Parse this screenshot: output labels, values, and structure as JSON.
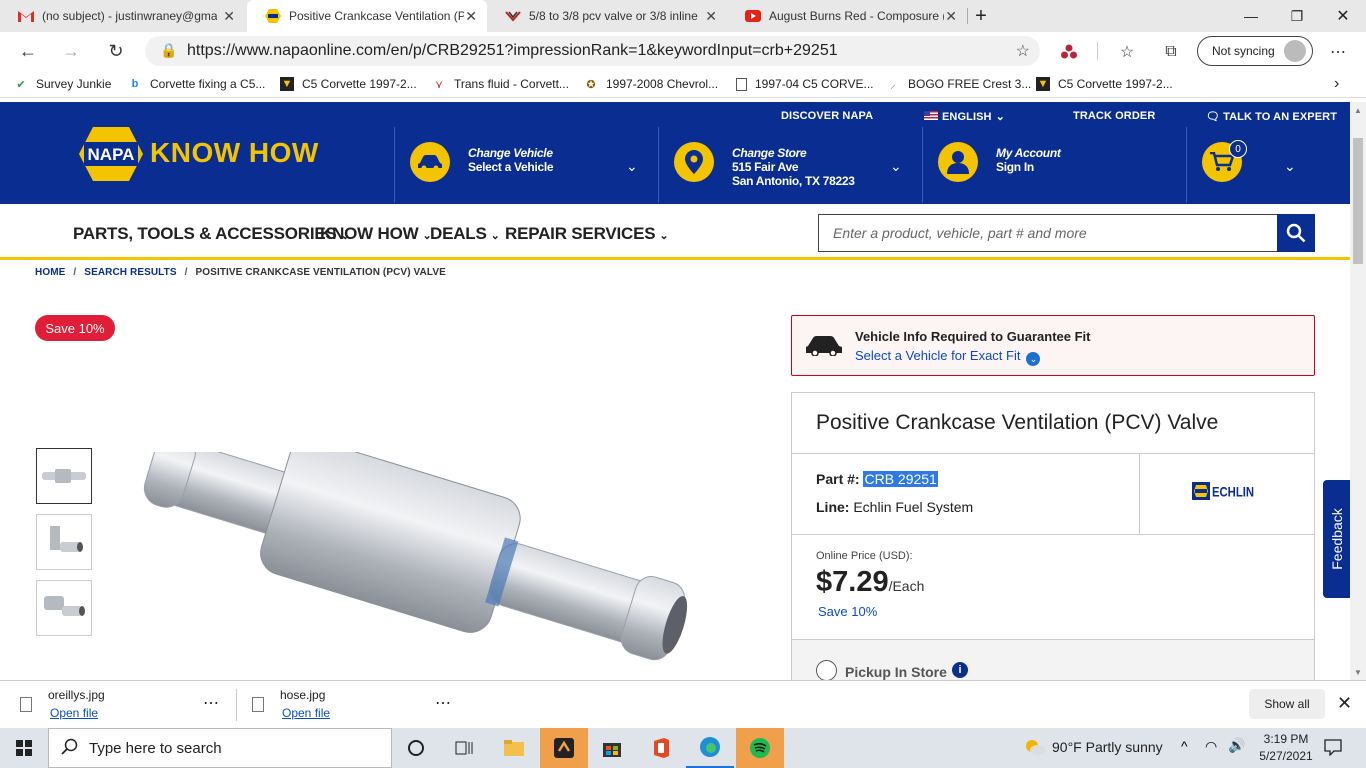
{
  "browser": {
    "tabs": [
      {
        "title": "(no subject) - justinwraney@gma",
        "icon": "gmail-icon"
      },
      {
        "title": "Positive Crankcase Ventilation (P",
        "icon": "napa-icon"
      },
      {
        "title": "5/8 to 3/8 pcv valve or 3/8 inline",
        "icon": "corvette-icon"
      },
      {
        "title": "August Burns Red - Composure (",
        "icon": "youtube-icon"
      }
    ],
    "url": "https://www.napaonline.com/en/p/CRB29251?impressionRank=1&keywordInput=crb+29251",
    "sync_label": "Not syncing",
    "bookmarks": [
      "Survey Junkie",
      "Corvette fixing a C5...",
      "C5 Corvette 1997-2...",
      "Trans fluid - Corvett...",
      "1997-2008 Chevrol...",
      "1997-04 C5 CORVE...",
      "BOGO FREE Crest 3...",
      "C5 Corvette 1997-2..."
    ]
  },
  "site": {
    "top_links": {
      "discover": "DISCOVER NAPA",
      "language": "ENGLISH",
      "track": "TRACK ORDER",
      "expert": "TALK TO AN EXPERT"
    },
    "logo": {
      "badge": "NAPA",
      "text": "KNOW HOW"
    },
    "vehicle": {
      "title": "Change Vehicle",
      "sub": "Select a Vehicle"
    },
    "store": {
      "title": "Change Store",
      "line1": "515 Fair Ave",
      "line2": "San Antonio, TX 78223"
    },
    "account": {
      "title": "My Account",
      "sub": "Sign In"
    },
    "cart_count": "0",
    "menu": [
      "PARTS, TOOLS & ACCESSORIES",
      "KNOW HOW",
      "DEALS",
      "REPAIR SERVICES"
    ],
    "search_placeholder": "Enter a product, vehicle, part # and more",
    "breadcrumb": {
      "home": "HOME",
      "results": "SEARCH RESULTS",
      "current": "POSITIVE CRANKCASE VENTILATION (PCV) VALVE"
    },
    "save_badge": "Save 10%",
    "fit": {
      "title": "Vehicle Info Required to Guarantee Fit",
      "link": "Select a Vehicle for Exact Fit"
    },
    "product": {
      "title": "Positive Crankcase Ventilation (PCV) Valve",
      "part_label": "Part #:",
      "part_number": "CRB 29251",
      "line_label": "Line:",
      "line_value": "Echlin Fuel System",
      "brand_logo": "ECHLIN",
      "price_label": "Online Price (USD):",
      "price": "$7.29",
      "price_unit": "/Each",
      "save": "Save 10%",
      "pickup": "Pickup In Store"
    },
    "feedback": "Feedback"
  },
  "downloads": [
    {
      "name": "oreillys.jpg",
      "action": "Open file"
    },
    {
      "name": "hose.jpg",
      "action": "Open file"
    }
  ],
  "downloads_show_all": "Show all",
  "taskbar": {
    "search_placeholder": "Type here to search",
    "weather": "90°F  Partly sunny",
    "time": "3:19 PM",
    "date": "5/27/2021"
  },
  "colors": {
    "napa_blue": "#0a2d92",
    "napa_yellow": "#f5c400",
    "sale_red": "#e01e37",
    "link_blue": "#0a4cc0"
  }
}
